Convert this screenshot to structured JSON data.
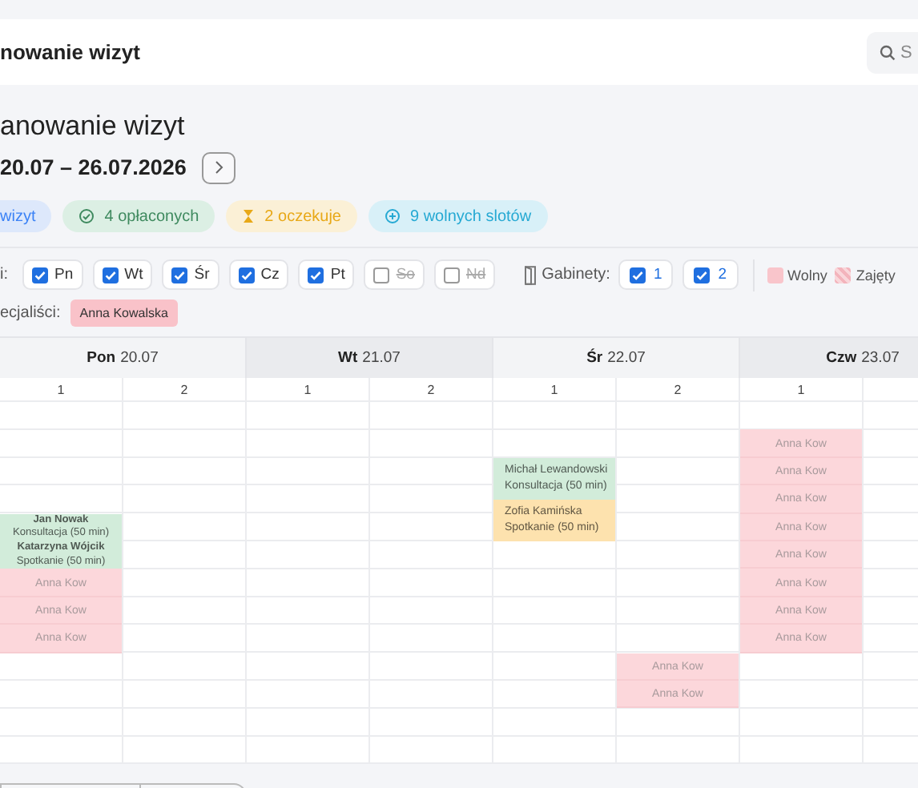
{
  "header": {
    "title": "nowanie wizyt",
    "search": {
      "placeholder": "S"
    }
  },
  "page": {
    "title": "anowanie wizyt",
    "range": "20.07 – 26.07.2026"
  },
  "stats": [
    {
      "kind": "total",
      "label": "wizyt"
    },
    {
      "kind": "paid",
      "label": "4 opłaconych"
    },
    {
      "kind": "pending",
      "label": "2 oczekuje"
    },
    {
      "kind": "free",
      "label": "9 wolnych slotów"
    }
  ],
  "filters": {
    "days_label": "i:",
    "days": [
      {
        "label": "Pn",
        "checked": true
      },
      {
        "label": "Wt",
        "checked": true
      },
      {
        "label": "Śr",
        "checked": true
      },
      {
        "label": "Cz",
        "checked": true
      },
      {
        "label": "Pt",
        "checked": true
      },
      {
        "label": "So",
        "checked": false
      },
      {
        "label": "Nd",
        "checked": false
      }
    ],
    "rooms_label": "Gabinety:",
    "rooms": [
      {
        "label": "1",
        "checked": true
      },
      {
        "label": "2",
        "checked": true
      }
    ],
    "legend": [
      {
        "kind": "free",
        "label": "Wolny"
      },
      {
        "kind": "busy",
        "label": "Zajęty"
      }
    ],
    "specialists_label": "ecjaliści:",
    "specialists": [
      {
        "name": "Anna Kowalska"
      }
    ]
  },
  "calendar": {
    "days": [
      {
        "name": "Pon",
        "date": "20.07"
      },
      {
        "name": "Wt",
        "date": "21.07"
      },
      {
        "name": "Śr",
        "date": "22.07"
      },
      {
        "name": "Czw",
        "date": "23.07"
      }
    ],
    "columns": [
      {
        "header": "1",
        "cells": [
          {
            "kind": "empty"
          },
          {
            "kind": "empty"
          },
          {
            "kind": "empty"
          },
          {
            "kind": "empty"
          },
          {
            "kind": "group",
            "color": "#d2ecda",
            "entries": [
              {
                "name": "Jan Nowak",
                "service": "Konsultacja (50 min)"
              },
              {
                "name": "Katarzyna Wójcik",
                "service": "Spotkanie (50 min)"
              }
            ]
          },
          {
            "kind": "free",
            "label": "Anna Kow"
          },
          {
            "kind": "free",
            "label": "Anna Kow"
          },
          {
            "kind": "free",
            "label": "Anna Kow"
          },
          {
            "kind": "empty"
          },
          {
            "kind": "empty"
          },
          {
            "kind": "empty"
          },
          {
            "kind": "empty"
          }
        ]
      },
      {
        "header": "2",
        "cells": [
          {
            "kind": "empty"
          },
          {
            "kind": "empty"
          },
          {
            "kind": "empty"
          },
          {
            "kind": "empty"
          },
          {
            "kind": "empty"
          },
          {
            "kind": "empty"
          },
          {
            "kind": "empty"
          },
          {
            "kind": "empty"
          },
          {
            "kind": "empty"
          },
          {
            "kind": "empty"
          },
          {
            "kind": "empty"
          },
          {
            "kind": "empty"
          },
          {
            "kind": "empty"
          }
        ]
      },
      {
        "header": "1",
        "cells": [
          {
            "kind": "empty"
          },
          {
            "kind": "empty"
          },
          {
            "kind": "empty"
          },
          {
            "kind": "empty"
          },
          {
            "kind": "empty"
          },
          {
            "kind": "empty"
          },
          {
            "kind": "empty"
          },
          {
            "kind": "empty"
          },
          {
            "kind": "empty"
          },
          {
            "kind": "empty"
          },
          {
            "kind": "empty"
          },
          {
            "kind": "empty"
          },
          {
            "kind": "empty"
          }
        ]
      },
      {
        "header": "2",
        "cells": [
          {
            "kind": "empty"
          },
          {
            "kind": "empty"
          },
          {
            "kind": "empty"
          },
          {
            "kind": "empty"
          },
          {
            "kind": "empty"
          },
          {
            "kind": "empty"
          },
          {
            "kind": "empty"
          },
          {
            "kind": "empty"
          },
          {
            "kind": "empty"
          },
          {
            "kind": "empty"
          },
          {
            "kind": "empty"
          },
          {
            "kind": "empty"
          },
          {
            "kind": "empty"
          }
        ]
      },
      {
        "header": "1",
        "cells": [
          {
            "kind": "empty"
          },
          {
            "kind": "empty"
          },
          {
            "kind": "visit",
            "color": "#d2ecda",
            "entries": [
              {
                "name": "Michał Lewandowski",
                "service": "Konsultacja (50 min)"
              }
            ]
          },
          {
            "kind": "visit",
            "color": "#fde2ae",
            "entries": [
              {
                "name": "Zofia Kamińska",
                "service": "Spotkanie (50 min)"
              }
            ]
          },
          {
            "kind": "empty"
          },
          {
            "kind": "empty"
          },
          {
            "kind": "empty"
          },
          {
            "kind": "empty"
          },
          {
            "kind": "empty"
          },
          {
            "kind": "empty"
          },
          {
            "kind": "empty"
          },
          {
            "kind": "empty"
          }
        ]
      },
      {
        "header": "2",
        "cells": [
          {
            "kind": "empty"
          },
          {
            "kind": "empty"
          },
          {
            "kind": "empty"
          },
          {
            "kind": "empty"
          },
          {
            "kind": "empty"
          },
          {
            "kind": "empty"
          },
          {
            "kind": "empty"
          },
          {
            "kind": "empty"
          },
          {
            "kind": "empty"
          },
          {
            "kind": "free",
            "label": "Anna Kow"
          },
          {
            "kind": "free",
            "label": "Anna Kow"
          },
          {
            "kind": "empty"
          },
          {
            "kind": "empty"
          }
        ]
      },
      {
        "header": "1",
        "cells": [
          {
            "kind": "empty"
          },
          {
            "kind": "free",
            "label": "Anna Kow"
          },
          {
            "kind": "free",
            "label": "Anna Kow"
          },
          {
            "kind": "free",
            "label": "Anna Kow"
          },
          {
            "kind": "free",
            "label": "Anna Kow"
          },
          {
            "kind": "free",
            "label": "Anna Kow"
          },
          {
            "kind": "free",
            "label": "Anna Kow"
          },
          {
            "kind": "free",
            "label": "Anna Kow"
          },
          {
            "kind": "free",
            "label": "Anna Kow"
          },
          {
            "kind": "empty"
          },
          {
            "kind": "empty"
          },
          {
            "kind": "empty"
          },
          {
            "kind": "empty"
          }
        ]
      },
      {
        "cells": [
          {
            "kind": "empty"
          },
          {
            "kind": "empty"
          },
          {
            "kind": "empty"
          },
          {
            "kind": "empty"
          },
          {
            "kind": "empty"
          },
          {
            "kind": "empty"
          },
          {
            "kind": "empty"
          },
          {
            "kind": "empty"
          },
          {
            "kind": "empty"
          },
          {
            "kind": "empty"
          },
          {
            "kind": "empty"
          },
          {
            "kind": "empty"
          },
          {
            "kind": "empty"
          }
        ]
      }
    ]
  }
}
